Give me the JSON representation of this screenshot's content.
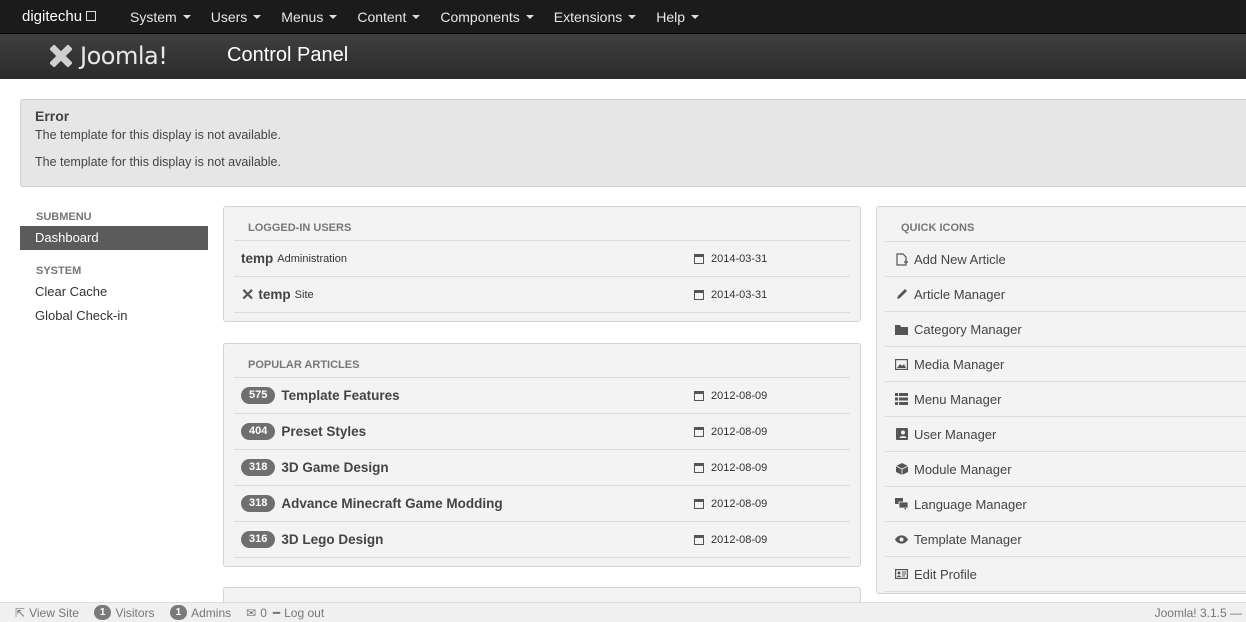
{
  "navbar": {
    "brand": "digitechu",
    "items": [
      {
        "label": "System"
      },
      {
        "label": "Users"
      },
      {
        "label": "Menus"
      },
      {
        "label": "Content"
      },
      {
        "label": "Components"
      },
      {
        "label": "Extensions"
      },
      {
        "label": "Help"
      }
    ]
  },
  "header": {
    "logo_text": "Joomla!",
    "title": "Control Panel"
  },
  "alert": {
    "heading": "Error",
    "messages": [
      "The template for this display is not available.",
      "The template for this display is not available."
    ]
  },
  "sidebar": {
    "submenu_heading": "SUBMENU",
    "dashboard": "Dashboard",
    "system_heading": "SYSTEM",
    "items": [
      {
        "label": "Clear Cache"
      },
      {
        "label": "Global Check-in"
      }
    ]
  },
  "logged_in": {
    "heading": "LOGGED-IN USERS",
    "rows": [
      {
        "name": "temp",
        "context": "Administration",
        "date": "2014-03-31"
      },
      {
        "name": "temp",
        "context": "Site",
        "date": "2014-03-31"
      }
    ]
  },
  "popular": {
    "heading": "POPULAR ARTICLES",
    "rows": [
      {
        "hits": "575",
        "title": "Template Features",
        "date": "2012-08-09"
      },
      {
        "hits": "404",
        "title": "Preset Styles",
        "date": "2012-08-09"
      },
      {
        "hits": "318",
        "title": "3D Game Design",
        "date": "2012-08-09"
      },
      {
        "hits": "318",
        "title": "Advance Minecraft Game Modding",
        "date": "2012-08-09"
      },
      {
        "hits": "316",
        "title": "3D Lego Design",
        "date": "2012-08-09"
      }
    ]
  },
  "quick_icons": {
    "heading": "QUICK ICONS",
    "items": [
      {
        "label": "Add New Article",
        "icon": "new-article-icon"
      },
      {
        "label": "Article Manager",
        "icon": "pencil-icon"
      },
      {
        "label": "Category Manager",
        "icon": "folder-icon"
      },
      {
        "label": "Media Manager",
        "icon": "image-icon"
      },
      {
        "label": "Menu Manager",
        "icon": "list-icon"
      },
      {
        "label": "User Manager",
        "icon": "user-icon"
      },
      {
        "label": "Module Manager",
        "icon": "cube-icon"
      },
      {
        "label": "Language Manager",
        "icon": "comments-icon"
      },
      {
        "label": "Template Manager",
        "icon": "eye-icon"
      },
      {
        "label": "Edit Profile",
        "icon": "vcard-icon"
      }
    ]
  },
  "status": {
    "view_site": "View Site",
    "visitors_count": "1",
    "visitors_label": "Visitors",
    "admins_count": "1",
    "admins_label": "Admins",
    "messages_count": "0",
    "logout": "Log out",
    "version": "Joomla! 3.1.5"
  }
}
